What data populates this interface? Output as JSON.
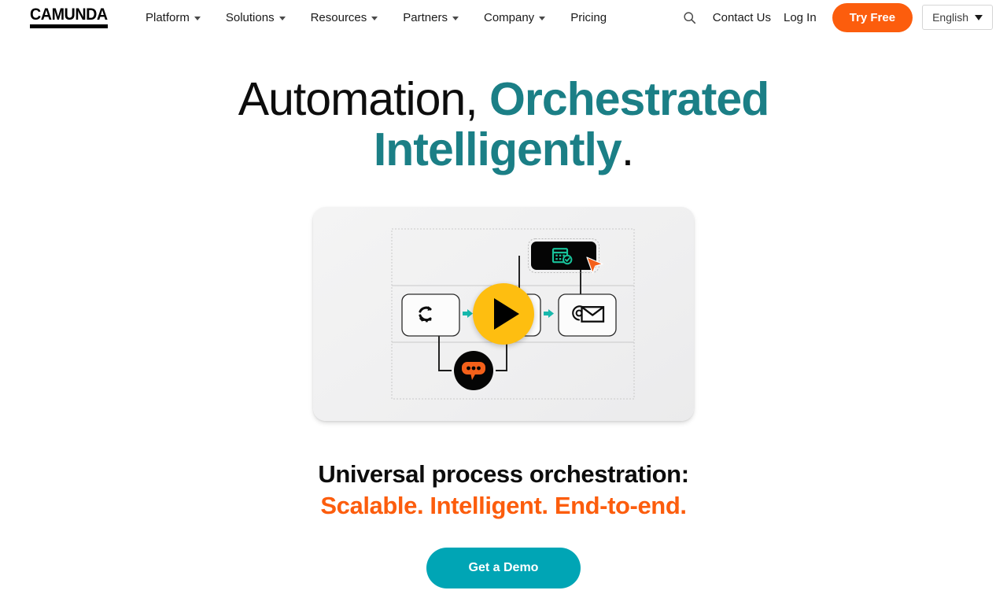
{
  "brand": {
    "logo_text": "CAMUNDA",
    "accent_teal": "#1b7f86",
    "accent_orange": "#fc5d0d",
    "accent_cyan": "#00a5b5",
    "accent_yellow": "#febe10"
  },
  "nav": {
    "items": [
      {
        "label": "Platform",
        "has_dropdown": true
      },
      {
        "label": "Solutions",
        "has_dropdown": true
      },
      {
        "label": "Resources",
        "has_dropdown": true
      },
      {
        "label": "Partners",
        "has_dropdown": true
      },
      {
        "label": "Company",
        "has_dropdown": true
      },
      {
        "label": "Pricing",
        "has_dropdown": false
      }
    ],
    "search_icon": "search-icon",
    "contact_label": "Contact Us",
    "login_label": "Log In",
    "try_free_label": "Try Free",
    "language_label": "English"
  },
  "hero": {
    "title_part1": "Automation, ",
    "title_part2": "Orchestrated Intelligently",
    "title_part3": "."
  },
  "video": {
    "play_icon": "play-icon",
    "diagram": {
      "service_task_icon": "gear-refresh-icon",
      "email_task_icon": "at-envelope-icon",
      "calendar_icon": "calendar-check-icon",
      "chat_icon": "chat-bubble-icon",
      "cursor_icon": "cursor-pointer-icon"
    }
  },
  "subhead": {
    "line1": "Universal process orchestration:",
    "line2": "Scalable. Intelligent. End-to-end."
  },
  "cta": {
    "demo_label": "Get a Demo"
  }
}
